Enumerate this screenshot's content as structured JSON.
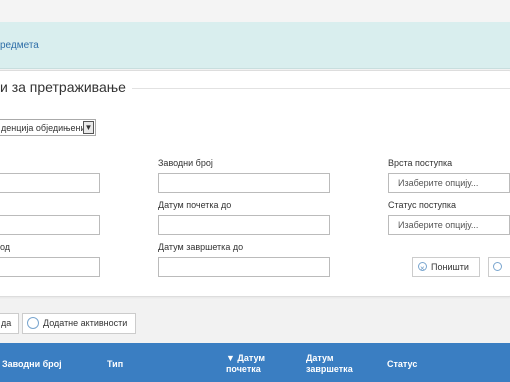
{
  "info": {
    "text": "редмета"
  },
  "filter": {
    "legend": "и за претраживање",
    "evidence_select": "денција обједињени",
    "fields": {
      "zavodni_broj": {
        "label": "Заводни број"
      },
      "datum_pocetka_do": {
        "label": "Датум почетка до"
      },
      "datum_zavrsetka_od": {
        "label": "од"
      },
      "datum_zavrsetka_do": {
        "label": "Датум завршетка до"
      },
      "vrsta_postupka": {
        "label": "Врста поступка",
        "value": "Изаберите опцију..."
      },
      "status_postupka": {
        "label": "Статус поступка",
        "value": "Изаберите опцију..."
      }
    },
    "reset_button": "Поништи"
  },
  "actions": {
    "left_button": "да",
    "additional_button": "Додатне активности"
  },
  "table": {
    "headers": [
      "Заводни број",
      "Тип",
      "▼ Датум почетка",
      "Датум завршетка",
      "Статус"
    ]
  },
  "colors": {
    "header_bg": "#3a7ec2",
    "info_bg": "#d9eeee",
    "link": "#2f6fa8"
  }
}
